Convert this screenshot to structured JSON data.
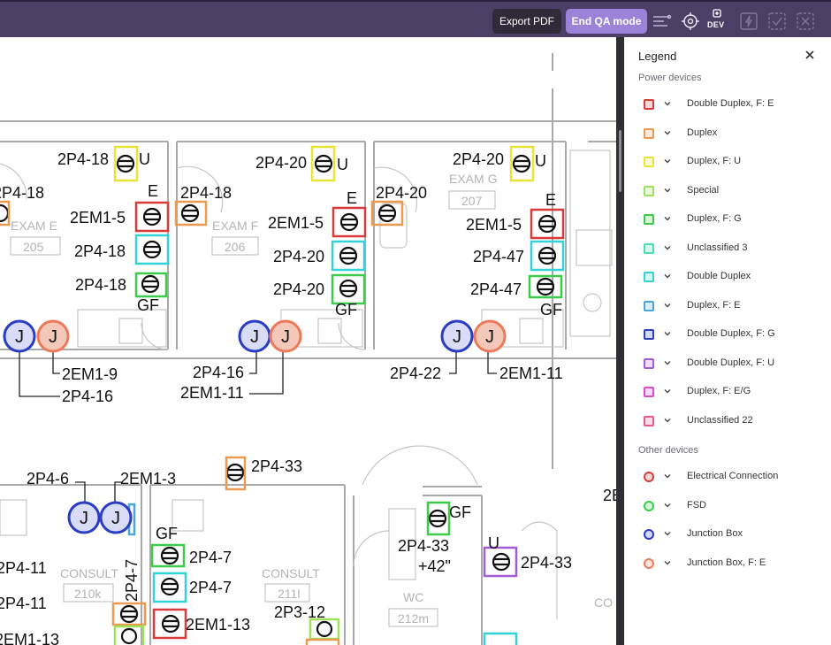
{
  "toolbar": {
    "export_label": "Export PDF",
    "end_qa_label": "End QA mode",
    "dev_label": "DEV",
    "icons": [
      "sliders-icon",
      "crosshair-icon",
      "dev-plus-icon",
      "lightning-icon",
      "checkbox-icon",
      "close-box-icon"
    ]
  },
  "legend": {
    "title": "Legend",
    "power_section": "Power devices",
    "other_section": "Other devices",
    "power_items": [
      {
        "label": "Double Duplex, F: E",
        "color": "#d93b3b"
      },
      {
        "label": "Duplex",
        "color": "#ec9a4f"
      },
      {
        "label": "Duplex, F: U",
        "color": "#e8e536"
      },
      {
        "label": "Special",
        "color": "#9de35a"
      },
      {
        "label": "Duplex, F: G",
        "color": "#3ccc4c"
      },
      {
        "label": "Unclassified 3",
        "color": "#43e0b0"
      },
      {
        "label": "Double Duplex",
        "color": "#33d2d8"
      },
      {
        "label": "Duplex, F: E",
        "color": "#4aa5e0"
      },
      {
        "label": "Double Duplex, F: G",
        "color": "#2a3bc4"
      },
      {
        "label": "Double Duplex, F: U",
        "color": "#a35cd8"
      },
      {
        "label": "Duplex, F: E/G",
        "color": "#e04ad2"
      },
      {
        "label": "Unclassified 22",
        "color": "#e85a8a"
      }
    ],
    "other_items": [
      {
        "label": "Electrical Connection",
        "color": "#d93b3b"
      },
      {
        "label": "FSD",
        "color": "#3ccc4c"
      },
      {
        "label": "Junction Box",
        "color": "#2a3bc4"
      },
      {
        "label": "Junction Box, F: E",
        "color": "#ec7a5a"
      }
    ]
  },
  "plan": {
    "rooms": [
      {
        "name": "EXAM E",
        "number": "205"
      },
      {
        "name": "EXAM F",
        "number": "206"
      },
      {
        "name": "EXAM G",
        "number": "207"
      },
      {
        "name": "CONSULT",
        "number": "210k"
      },
      {
        "name": "CONSULT",
        "number": "211l"
      },
      {
        "name": "WC",
        "number": "212m"
      }
    ],
    "labels": {
      "l_2p4_18_a": "2P4-18",
      "l_2p4_18_b": "2P4-18",
      "l_2p4_18_c": "2P4-18",
      "l_2p4_18_d": "2P4-18",
      "l_2p4_18_e": "2P4-18",
      "l_2p4_20_a": "2P4-20",
      "l_2p4_20_b": "2P4-20",
      "l_2p4_20_c": "2P4-20",
      "l_2p4_20_d": "2P4-20",
      "l_2p4_20_e": "2P4-20",
      "l_2p4_47_a": "2P4-47",
      "l_2p4_47_b": "2P4-47",
      "l_2em1_5_a": "2EM1-5",
      "l_2em1_5_b": "2EM1-5",
      "l_2em1_5_c": "2EM1-5",
      "l_2em1_9": "2EM1-9",
      "l_2p4_16_a": "2P4-16",
      "l_2p4_16_b": "2P4-16",
      "l_2em1_11_a": "2EM1-11",
      "l_2em1_11_b": "2EM1-11",
      "l_2p4_22": "2P4-22",
      "l_2p4_6": "2P4-6",
      "l_2em1_3": "2EM1-3",
      "l_2p4_33_a": "2P4-33",
      "l_2p4_33_b": "2P4-33",
      "l_2p4_33_c": "2P4-33",
      "l_42": "+42\"",
      "l_2p4_11_a": "2P4-11",
      "l_2p4_11_b": "2P4-11",
      "l_2p4_7_a": "2P4-7",
      "l_2p4_7_b": "2P4-7",
      "l_2p4_7_c": "2P4-7",
      "l_2em1_13_a": "2EM1-13",
      "l_2em1_13_b": "2EM1-13",
      "l_2p3_12": "2P3-12",
      "u1": "U",
      "u2": "U",
      "u3": "U",
      "u4": "U",
      "e1": "E",
      "e2": "E",
      "e3": "E",
      "gf1": "GF",
      "gf2": "GF",
      "gf3": "GF",
      "gf4": "GF",
      "gf5": "GF",
      "j": "J",
      "edge_2e": "2E",
      "edge_co": "CO"
    }
  }
}
